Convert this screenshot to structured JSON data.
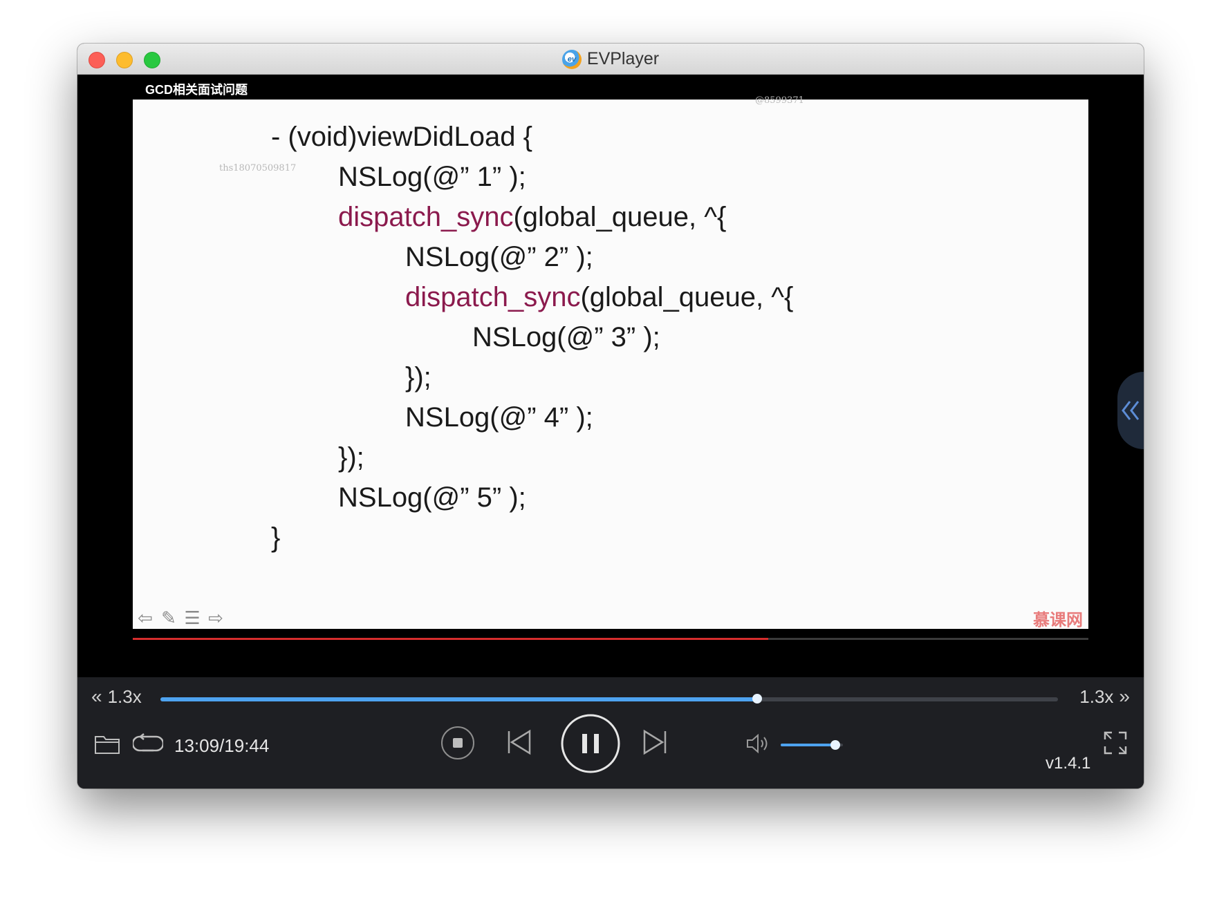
{
  "window": {
    "title": "EVPlayer",
    "app_icon_text": "ev"
  },
  "video": {
    "title": "GCD相关面试问题",
    "watermark_1": "ths18070509817",
    "watermark_2": "@8599371",
    "code_lines": [
      {
        "indent": 0,
        "keyword": "",
        "text": "- (void)viewDidLoad {"
      },
      {
        "indent": 1,
        "keyword": "",
        "text": "NSLog(@” 1” );"
      },
      {
        "indent": 1,
        "keyword": "dispatch_sync",
        "text": "(global_queue, ^{"
      },
      {
        "indent": 2,
        "keyword": "",
        "text": "NSLog(@” 2” );"
      },
      {
        "indent": 2,
        "keyword": "dispatch_sync",
        "text": "(global_queue, ^{"
      },
      {
        "indent": 3,
        "keyword": "",
        "text": "NSLog(@” 3” );"
      },
      {
        "indent": 2,
        "keyword": "",
        "text": "});"
      },
      {
        "indent": 2,
        "keyword": "",
        "text": "NSLog(@” 4” );"
      },
      {
        "indent": 1,
        "keyword": "",
        "text": "});"
      },
      {
        "indent": 1,
        "keyword": "",
        "text": "NSLog(@” 5” );"
      },
      {
        "indent": 0,
        "keyword": "",
        "text": "}"
      }
    ],
    "brand": "慕课网",
    "slide_tools": [
      "arrow-left-icon",
      "pen-icon",
      "menu-icon",
      "arrow-right-icon"
    ],
    "red_progress": 0.665
  },
  "controls": {
    "speed_left": "1.3x",
    "speed_right": "1.3x",
    "seek_progress": 0.665,
    "time": "13:09/19:44",
    "volume": 0.88,
    "version": "v1.4.1",
    "accent": "#4ea3f0",
    "keyword_color": "#8b1a4d"
  }
}
